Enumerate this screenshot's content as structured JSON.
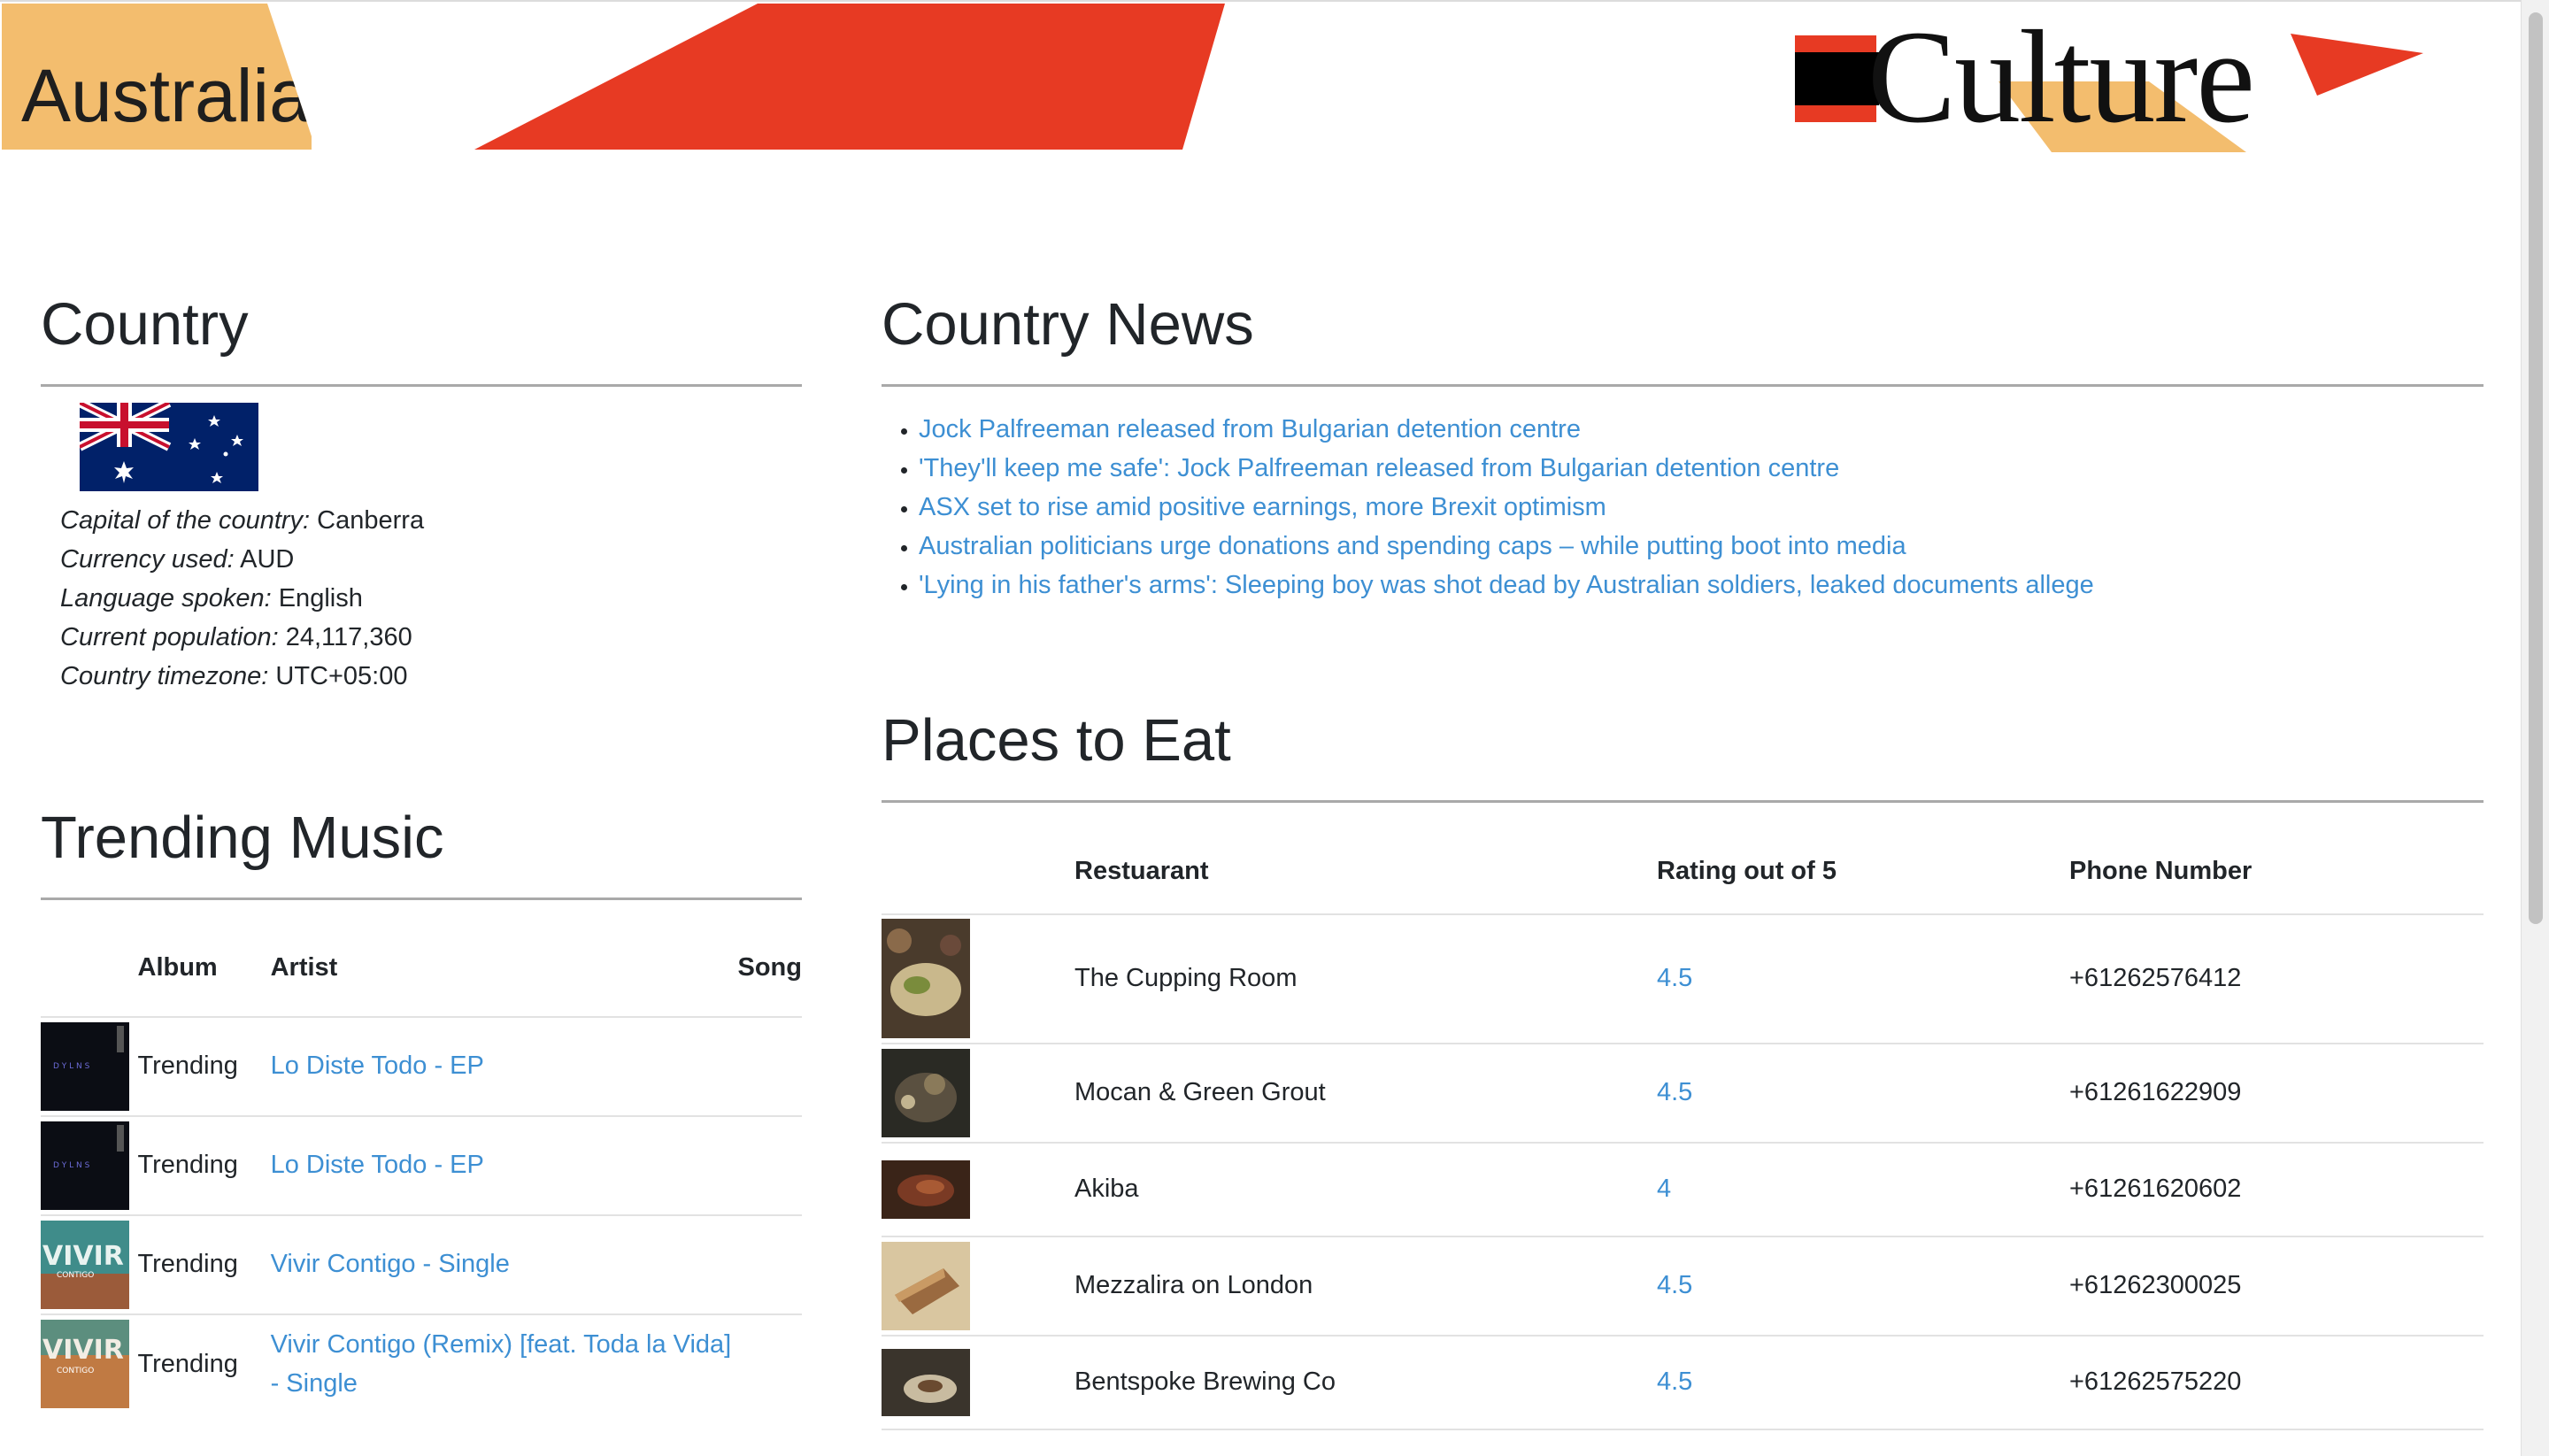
{
  "header": {
    "country_name": "Australia",
    "logo_text": "Culture"
  },
  "colors": {
    "accent_red": "#e73a23",
    "accent_tan": "#f3bd6e",
    "link": "#3d8fd3"
  },
  "country": {
    "title": "Country",
    "flag_icon": "australia-flag",
    "facts": [
      {
        "label": "Capital of the country:",
        "value": "Canberra"
      },
      {
        "label": "Currency used:",
        "value": "AUD"
      },
      {
        "label": "Language spoken:",
        "value": "English"
      },
      {
        "label": "Current population:",
        "value": "24,117,360"
      },
      {
        "label": "Country timezone:",
        "value": "UTC+05:00"
      }
    ]
  },
  "music": {
    "title": "Trending Music",
    "headers": {
      "album": "Album",
      "artist": "Artist",
      "song": "Song"
    },
    "rows": [
      {
        "album_art": "album-dark-icon",
        "artist": "Trending",
        "song": "Lo Diste Todo - EP"
      },
      {
        "album_art": "album-dark-icon",
        "artist": "Trending",
        "song": "Lo Diste Todo - EP"
      },
      {
        "album_art": "album-vivir-icon",
        "artist": "Trending",
        "song": "Vivir Contigo - Single"
      },
      {
        "album_art": "album-vivir-remix-icon",
        "artist": "Trending",
        "song": "Vivir Contigo (Remix) [feat. Toda la Vida] - Single"
      }
    ]
  },
  "news": {
    "title": "Country News",
    "items": [
      "Jock Palfreeman released from Bulgarian detention centre",
      "'They'll keep me safe': Jock Palfreeman released from Bulgarian detention centre",
      "ASX set to rise amid positive earnings, more Brexit optimism",
      "Australian politicians urge donations and spending caps – while putting boot into media",
      "'Lying in his father's arms': Sleeping boy was shot dead by Australian soldiers, leaked documents allege"
    ]
  },
  "places": {
    "title": "Places to Eat",
    "headers": {
      "restaurant": "Restuarant",
      "rating": "Rating out of 5",
      "phone": "Phone Number"
    },
    "rows": [
      {
        "name": "The Cupping Room",
        "rating": "4.5",
        "phone": "+61262576412"
      },
      {
        "name": "Mocan & Green Grout",
        "rating": "4.5",
        "phone": "+61261622909"
      },
      {
        "name": "Akiba",
        "rating": "4",
        "phone": "+61261620602"
      },
      {
        "name": "Mezzalira on London",
        "rating": "4.5",
        "phone": "+61262300025"
      },
      {
        "name": "Bentspoke Brewing Co",
        "rating": "4.5",
        "phone": "+61262575220"
      }
    ]
  }
}
